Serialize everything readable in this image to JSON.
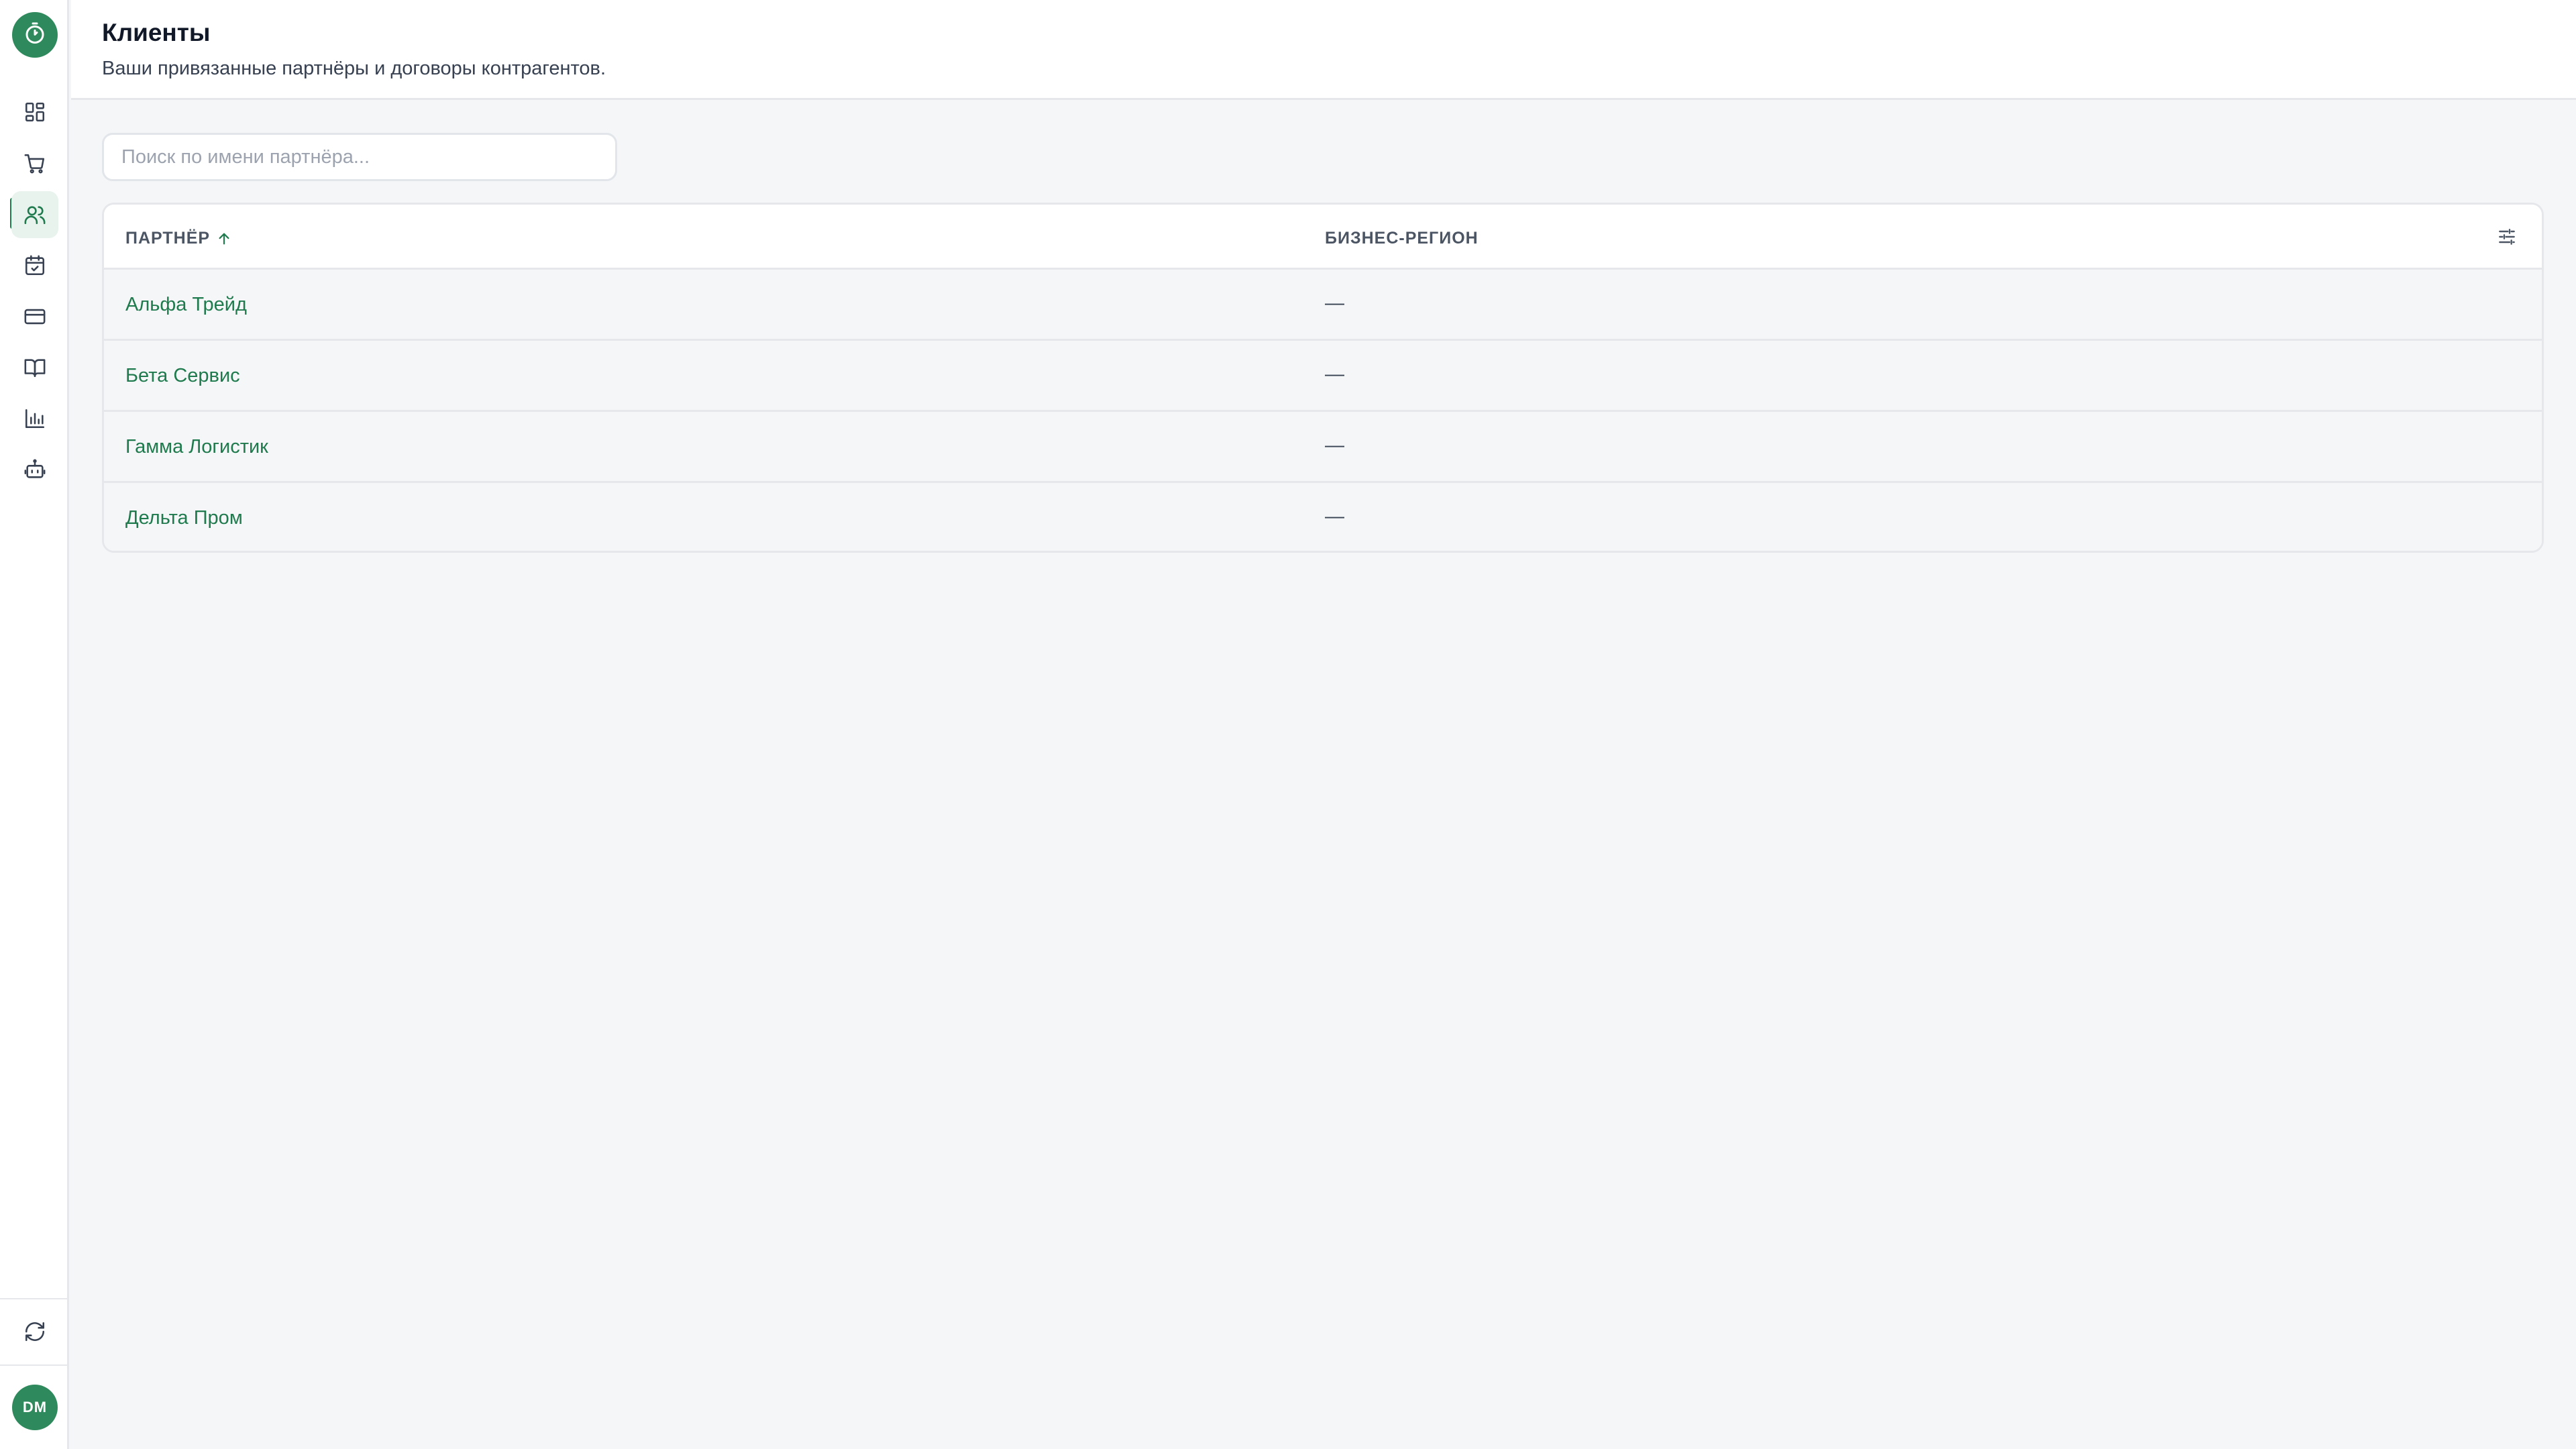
{
  "sidebar": {
    "logo_icon": "stopwatch-icon",
    "nav": [
      {
        "icon": "dashboard-icon",
        "active": false
      },
      {
        "icon": "cart-icon",
        "active": false
      },
      {
        "icon": "users-icon",
        "active": true
      },
      {
        "icon": "calendar-check-icon",
        "active": false
      },
      {
        "icon": "credit-card-icon",
        "active": false
      },
      {
        "icon": "book-icon",
        "active": false
      },
      {
        "icon": "bar-chart-icon",
        "active": false
      },
      {
        "icon": "robot-icon",
        "active": false
      }
    ],
    "sync_icon": "refresh-icon",
    "user_initials": "DM"
  },
  "header": {
    "title": "Клиенты",
    "subtitle": "Ваши привязанные партнёры и договоры контрагентов."
  },
  "search": {
    "placeholder": "Поиск по имени партнёра...",
    "value": ""
  },
  "table": {
    "columns": {
      "partner": "ПАРТНЁР",
      "region": "БИЗНЕС-РЕГИОН"
    },
    "sort": {
      "column": "partner",
      "direction": "asc"
    },
    "rows": [
      {
        "partner": "Альфа Трейд",
        "region": "—"
      },
      {
        "partner": "Бета Сервис",
        "region": "—"
      },
      {
        "partner": "Гамма Логистик",
        "region": "—"
      },
      {
        "partner": "Дельта Пром",
        "region": "—"
      }
    ]
  },
  "colors": {
    "accent": "#1f7a4d",
    "accent_bg": "#e7f3ec",
    "logo_bg": "#2e8a5c",
    "page_bg": "#f4f6f8"
  }
}
